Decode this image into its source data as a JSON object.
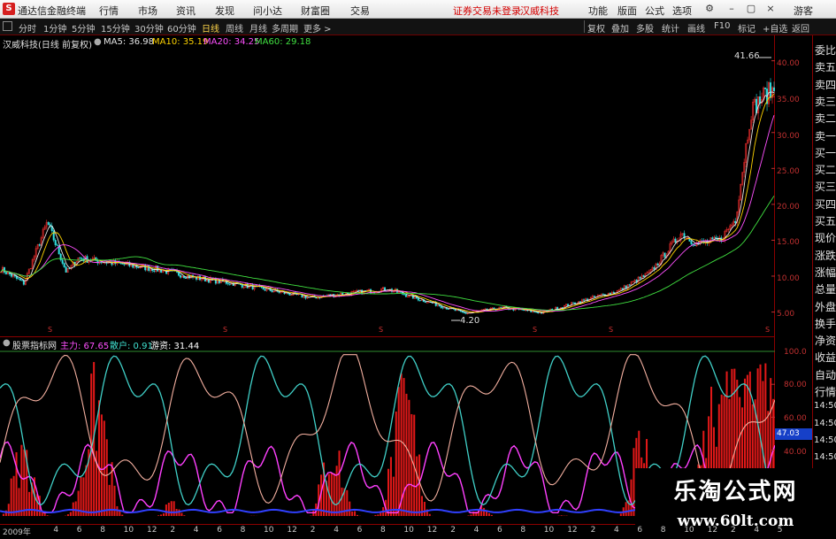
{
  "app": {
    "logo": "S",
    "title": "通达信金融终端",
    "menu": [
      "行情",
      "市场",
      "资讯",
      "发现",
      "问小达",
      "财富圈",
      "交易"
    ],
    "notice": "证券交易未登录",
    "stock": "汉威科技",
    "right_menu": [
      "功能",
      "版面",
      "公式",
      "选项"
    ],
    "guest": "游客",
    "window_controls": [
      "gear-icon",
      "minimize-icon",
      "restore-icon",
      "close-icon"
    ]
  },
  "toolbar": {
    "periods": [
      "分时",
      "1分钟",
      "5分钟",
      "15分钟",
      "30分钟",
      "60分钟",
      "日线",
      "周线",
      "月线",
      "多周期",
      "更多 >"
    ],
    "active": "日线",
    "right": [
      "复权",
      "叠加",
      "多股",
      "统计",
      "画线",
      "F10",
      "标记",
      "+自选",
      "返回"
    ]
  },
  "main_legend": {
    "name": "汉威科技(日线 前复权)",
    "ma": [
      {
        "label": "MA5: 36.98",
        "color": "#e6e6e6"
      },
      {
        "label": "MA10: 35.19",
        "color": "#ffd400"
      },
      {
        "label": "MA20: 34.25",
        "color": "#ff50ff"
      },
      {
        "label": "MA60: 29.18",
        "color": "#40e040"
      }
    ]
  },
  "price_axis": [
    "40.00",
    "35.00",
    "30.00",
    "25.00",
    "20.00",
    "15.00",
    "10.00",
    "5.00"
  ],
  "high_label": "41.66",
  "low_label": "4.20",
  "sidebar": [
    "委比",
    "卖五",
    "卖四",
    "卖三",
    "卖二",
    "卖一",
    "买一",
    "买二",
    "买三",
    "买四",
    "买五",
    "现价",
    "涨跌",
    "涨幅",
    "总量",
    "外盘",
    "换手",
    "净资",
    "收益",
    "自动",
    "行情",
    "14:50",
    "14:50",
    "14:50",
    "14:50",
    "14:50",
    "14:50",
    "14:50"
  ],
  "sub_legend": {
    "name": "股票指标网",
    "items": [
      {
        "label": "主力: 67.65",
        "color": "#ff50ff"
      },
      {
        "label": "散户: 0.91",
        "color": "#40e0d0"
      },
      {
        "label": "游资: 31.44",
        "color": "#ffffff"
      }
    ]
  },
  "sub_axis": [
    "100.0",
    "80.00",
    "60.00",
    "40.00"
  ],
  "current_value": "47.03",
  "x_axis": [
    "2009年",
    "4",
    "6",
    "8",
    "10",
    "12",
    "2",
    "4",
    "6",
    "8",
    "10",
    "12",
    "2",
    "4",
    "6",
    "8",
    "10",
    "12",
    "2",
    "4",
    "6",
    "8",
    "10",
    "12",
    "2",
    "4",
    "6",
    "8",
    "10",
    "12",
    "2",
    "4",
    "5"
  ],
  "markers": [
    "S",
    "S",
    "S",
    "S",
    "S",
    "S"
  ],
  "watermark": {
    "cn": "乐淘公式网",
    "url": "www.60lt.com"
  },
  "chart_data": {
    "type": "line",
    "series": [
      {
        "name": "MA5",
        "values": [
          36.98
        ]
      },
      {
        "name": "MA10",
        "values": [
          35.19
        ]
      },
      {
        "name": "MA20",
        "values": [
          34.25
        ]
      },
      {
        "name": "MA60",
        "values": [
          29.18
        ]
      },
      {
        "name": "主力",
        "values": [
          67.65
        ]
      },
      {
        "name": "散户",
        "values": [
          0.91
        ]
      },
      {
        "name": "游资",
        "values": [
          31.44
        ]
      }
    ],
    "ylim": [
      0,
      42
    ],
    "high": 41.66,
    "low": 4.2
  }
}
